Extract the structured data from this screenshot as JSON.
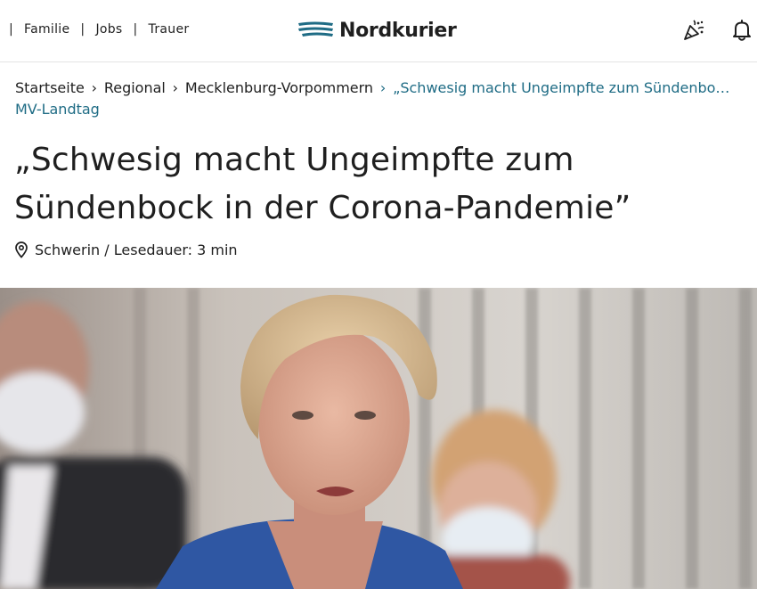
{
  "header": {
    "quick_links": [
      {
        "label": "Familie"
      },
      {
        "label": "Jobs"
      },
      {
        "label": "Trauer"
      }
    ],
    "separator": "|",
    "logo_text": "Nordkurier",
    "icons": [
      "confetti-icon",
      "bell-icon"
    ]
  },
  "breadcrumb": {
    "items": [
      "Startseite",
      "Regional",
      "Mecklenburg-Vorpommern"
    ],
    "current": "„Schwesig macht Ungeimpfte zum Sündenbock in der Corona-Pandemie”",
    "separator": "›"
  },
  "kicker": "MV-Landtag",
  "article": {
    "title": "„Schwesig macht Ungeimpfte zum Sündenbock in der Corona-Pandemie”",
    "meta": "Schwerin / Lesedauer: 3 min"
  },
  "colors": {
    "accent": "#1f6c85",
    "text": "#1f1f1f",
    "logo_blue": "#1f6c85"
  }
}
